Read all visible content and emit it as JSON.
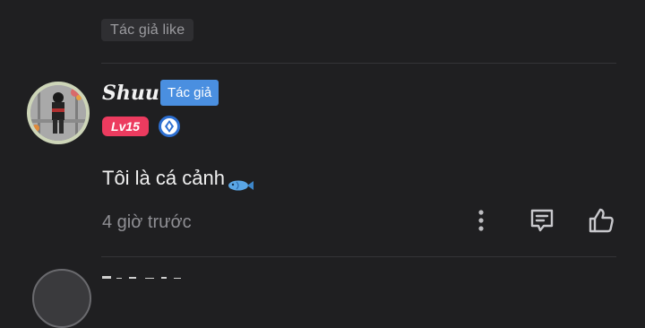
{
  "previous_comment": {
    "liked_badge": "Tác giả like"
  },
  "comment": {
    "username": "Shuu",
    "author_badge": "Tác giả",
    "level": "Lv15",
    "text": "Tôi là cá cảnh",
    "timestamp": "4 giờ trước",
    "icons": {
      "verify": "shield-verified-icon",
      "emoji": "fish-icon",
      "more": "more-vertical-icon",
      "reply": "comment-reply-icon",
      "like": "thumbs-up-icon"
    }
  },
  "colors": {
    "background": "#1f1f21",
    "author_badge": "#4a8fe0",
    "level_badge": "#ec3b5f",
    "muted_text": "#8f8f94"
  }
}
